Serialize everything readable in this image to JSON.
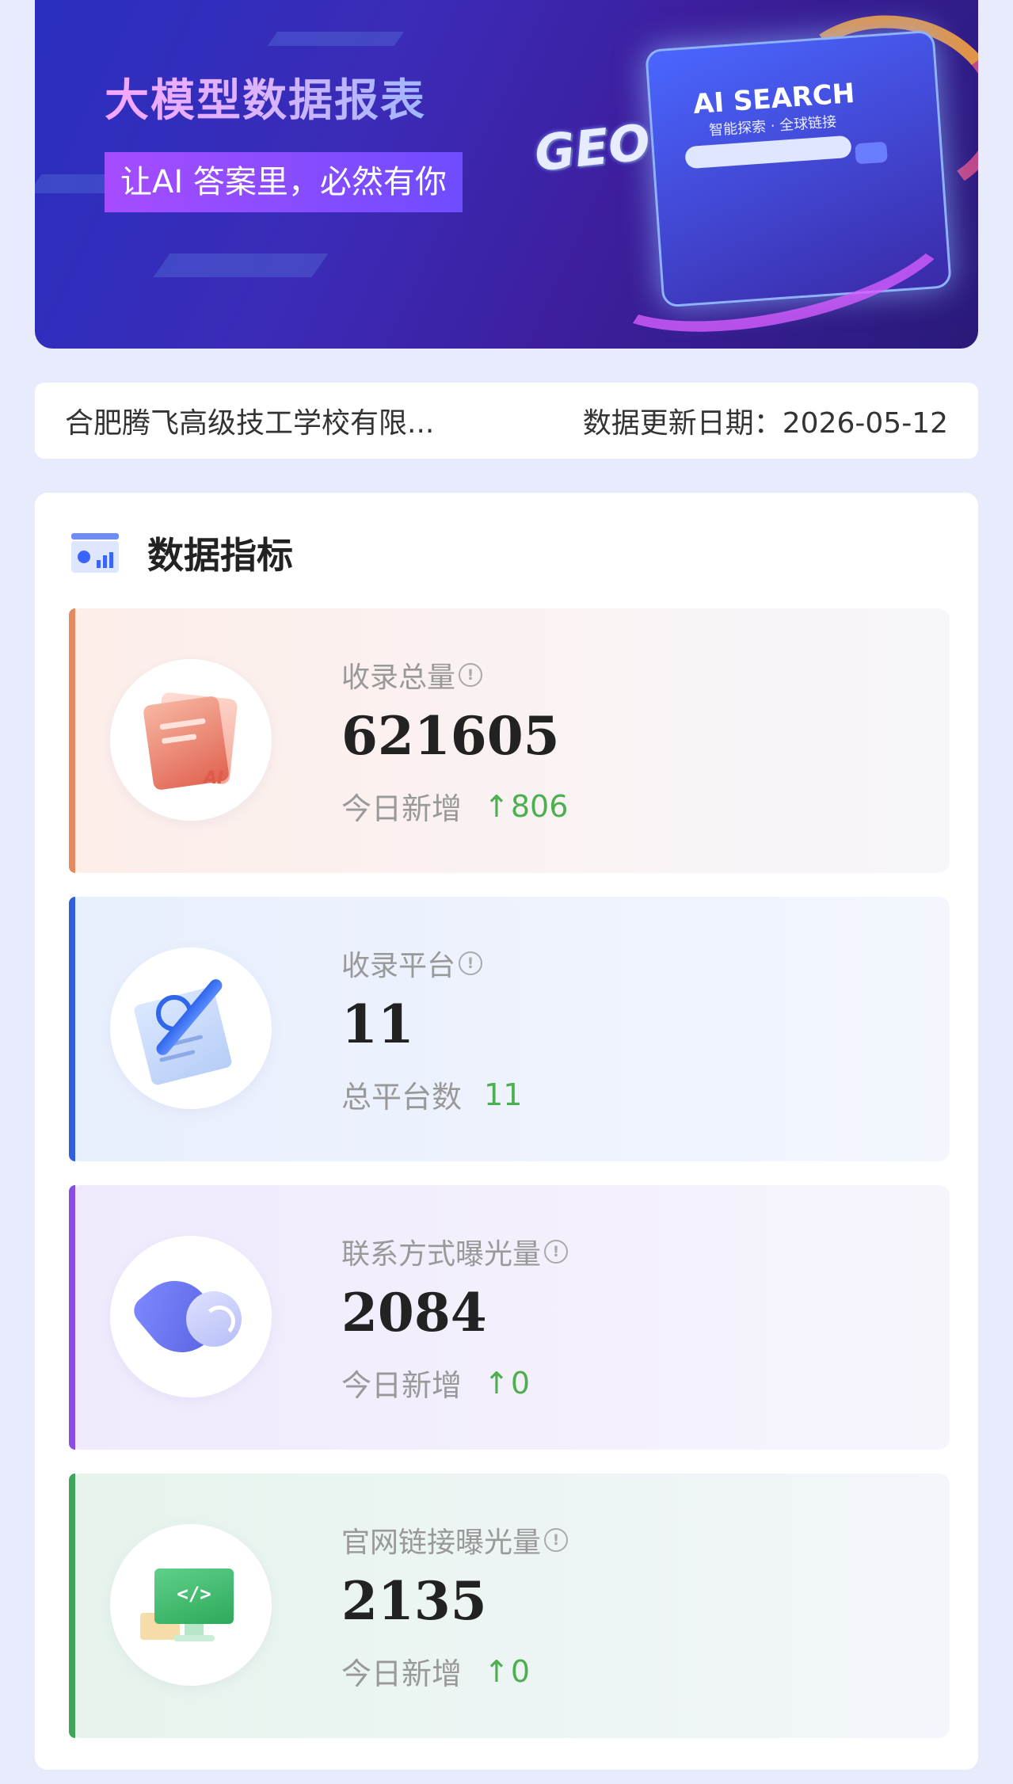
{
  "banner": {
    "title": "大模型数据报表",
    "subtitle": "让AI 答案里，必然有你",
    "art_heading": "AI SEARCH",
    "art_sub": "智能探索 · 全球链接",
    "art_badge": "GEO"
  },
  "info": {
    "company": "合肥腾飞高级技工学校有限...",
    "update_label": "数据更新日期：",
    "update_date": "2026-05-12"
  },
  "metrics": {
    "title": "数据指标",
    "cards": [
      {
        "label": "收录总量",
        "value": "621605",
        "sub_label": "今日新增",
        "sub_value": "806",
        "illustration": "document-ai-icon",
        "accent": "#e58a5e"
      },
      {
        "label": "收录平台",
        "value": "11",
        "sub_label": "总平台数",
        "sub_value": "11",
        "illustration": "pen-paper-icon",
        "accent": "#2f5fdc"
      },
      {
        "label": "联系方式曝光量",
        "value": "2084",
        "sub_label": "今日新增",
        "sub_value": "0",
        "illustration": "phone-icon",
        "accent": "#8a4ce6"
      },
      {
        "label": "官网链接曝光量",
        "value": "2135",
        "sub_label": "今日新增",
        "sub_value": "0",
        "illustration": "monitor-code-icon",
        "accent": "#3fa55a"
      }
    ]
  },
  "icons": {
    "info": "!",
    "arrow_up": "↑",
    "code": "</>",
    "ai": "AI"
  },
  "colors": {
    "page_bg": "#e8ebfb",
    "increase": "#4caf50"
  }
}
